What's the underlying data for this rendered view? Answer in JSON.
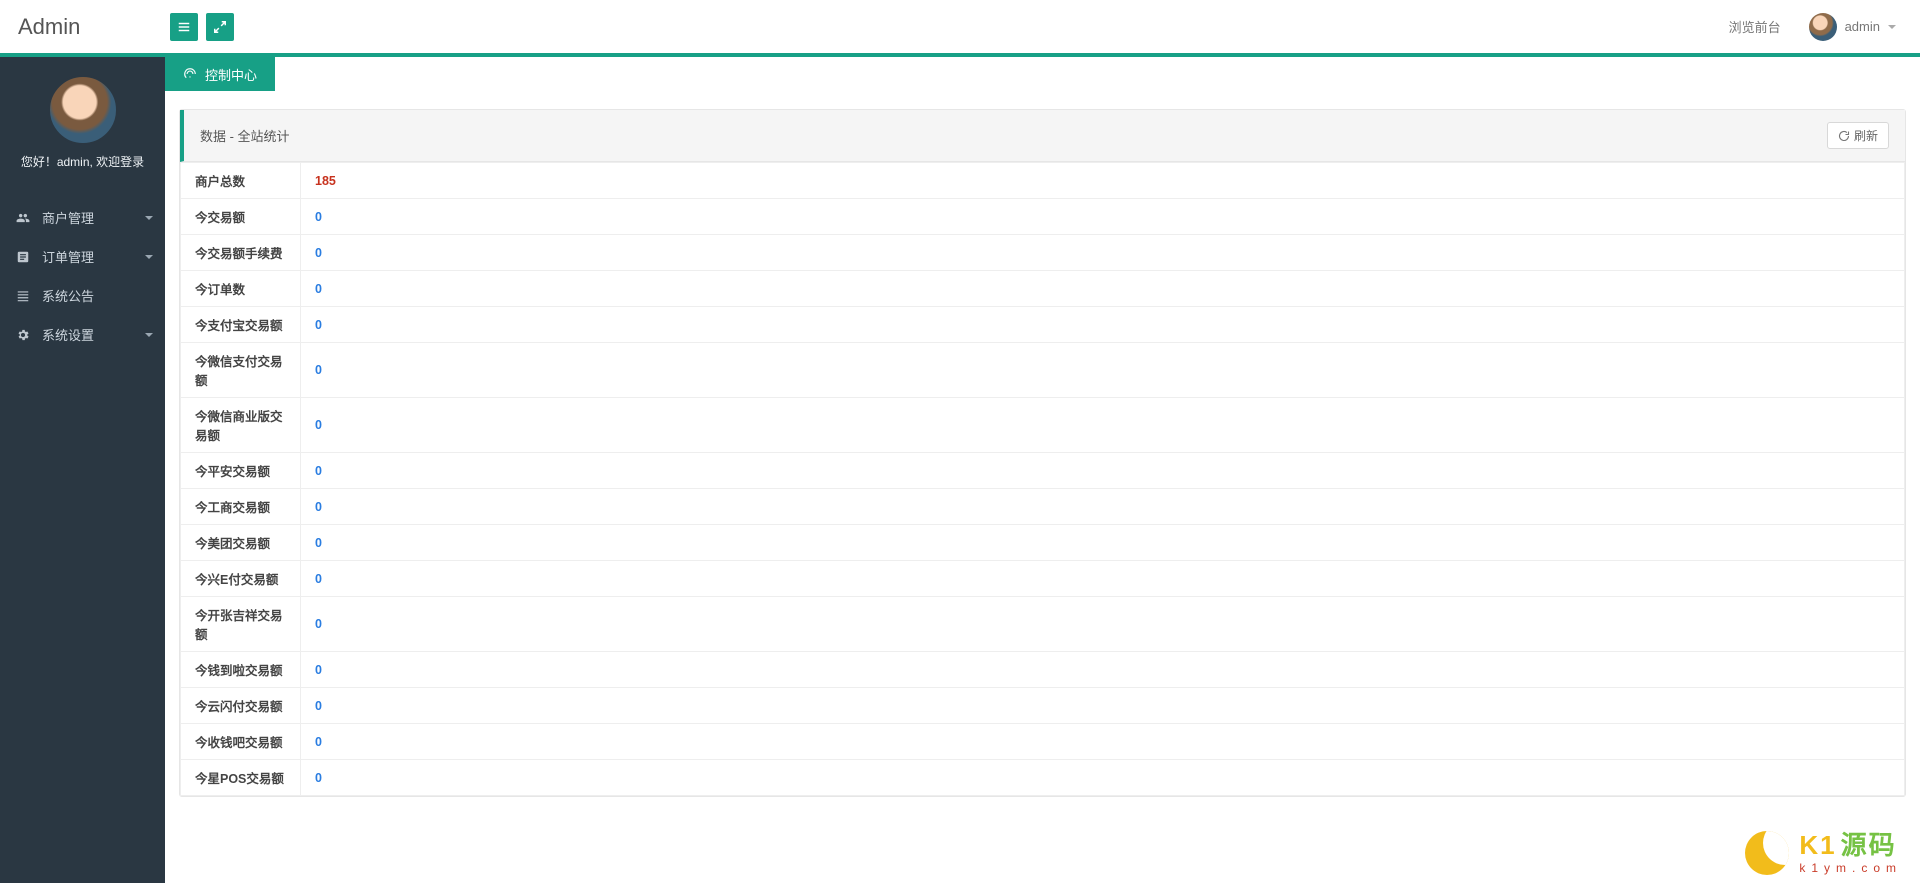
{
  "brand": "Admin",
  "topbar": {
    "view_frontend": "浏览前台",
    "username": "admin"
  },
  "sidebar": {
    "welcome": "您好！admin, 欢迎登录",
    "items": [
      {
        "icon": "users",
        "label": "商户管理",
        "expandable": true
      },
      {
        "icon": "orders",
        "label": "订单管理",
        "expandable": true
      },
      {
        "icon": "announce",
        "label": "系统公告",
        "expandable": false
      },
      {
        "icon": "settings",
        "label": "系统设置",
        "expandable": true
      }
    ]
  },
  "tabs": {
    "active": "控制中心"
  },
  "panel": {
    "title": "数据 - 全站统计",
    "refresh": "刷新"
  },
  "stats": [
    {
      "label": "商户总数",
      "value": "185",
      "highlight": true
    },
    {
      "label": "今交易额",
      "value": "0"
    },
    {
      "label": "今交易额手续费",
      "value": "0"
    },
    {
      "label": "今订单数",
      "value": "0"
    },
    {
      "label": "今支付宝交易额",
      "value": "0"
    },
    {
      "label": "今微信支付交易额",
      "value": "0"
    },
    {
      "label": "今微信商业版交易额",
      "value": "0"
    },
    {
      "label": "今平安交易额",
      "value": "0"
    },
    {
      "label": "今工商交易额",
      "value": "0"
    },
    {
      "label": "今美团交易额",
      "value": "0"
    },
    {
      "label": "今兴E付交易额",
      "value": "0"
    },
    {
      "label": "今开张吉祥交易额",
      "value": "0"
    },
    {
      "label": "今钱到啦交易额",
      "value": "0"
    },
    {
      "label": "今云闪付交易额",
      "value": "0"
    },
    {
      "label": "今收钱吧交易额",
      "value": "0"
    },
    {
      "label": "今星POS交易额",
      "value": "0"
    }
  ],
  "watermark": {
    "brand_letters": "K1",
    "brand_cn": "源码",
    "url": "k1ym.com"
  }
}
